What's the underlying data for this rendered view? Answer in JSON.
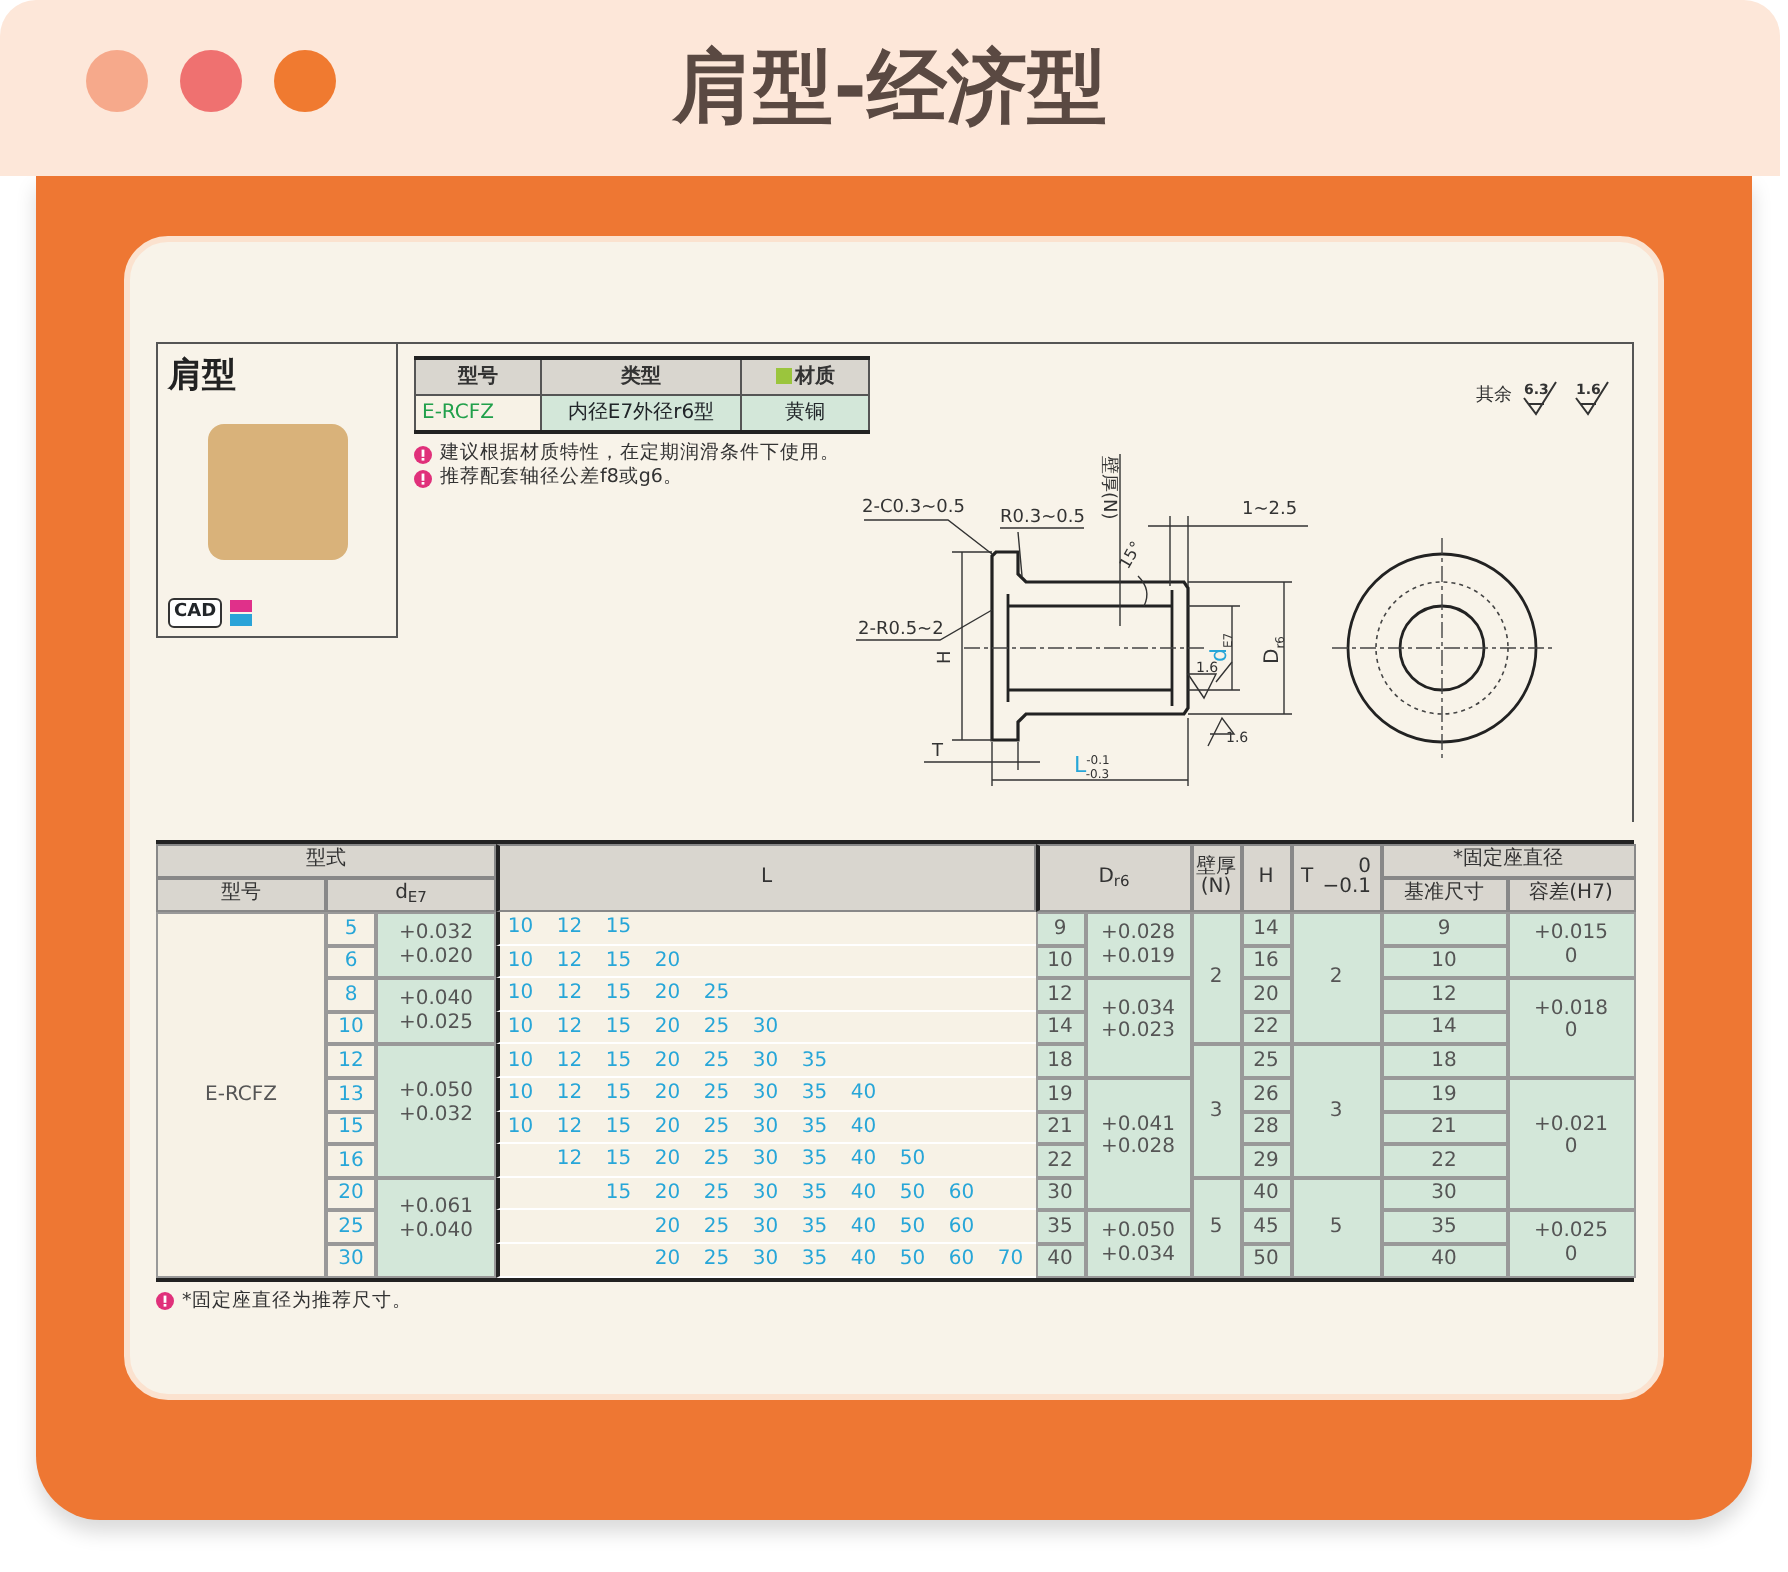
{
  "window": {
    "title": "肩型-经济型"
  },
  "product": {
    "title": "肩型",
    "cad": "CAD"
  },
  "spec_table": {
    "columns": [
      "型号",
      "类型",
      "材质"
    ],
    "rows": [
      [
        "E-RCFZ",
        "内径E7外径r6型",
        "黄铜"
      ]
    ]
  },
  "notes": [
    "建议根据材质特性，在定期润滑条件下使用。",
    "推荐配套轴径公差f8或g6。"
  ],
  "surface": {
    "label": "其余",
    "main": "6.3",
    "alt": "1.6"
  },
  "drawing": {
    "labels": [
      {
        "text": "2-C0.3~0.5"
      },
      {
        "text": "R0.3~0.5"
      },
      {
        "text": "壁厚(N)"
      },
      {
        "text": "1~2.5"
      },
      {
        "text": "15°"
      },
      {
        "text": "2-R0.5~2"
      },
      {
        "text": "H"
      },
      {
        "text": "T"
      },
      {
        "text": "L",
        "sup": "-0.1",
        "sub": "-0.3"
      },
      {
        "text": "d",
        "sub": "E7"
      },
      {
        "text": "D",
        "sub": "r6"
      },
      {
        "text": "1.6"
      },
      {
        "text": "1.6"
      }
    ]
  },
  "main_table": {
    "headers": {
      "group": "型式",
      "model": "型号",
      "d": "d$_{E7}$",
      "L": "L",
      "D": "D$_{r6}$",
      "N": [
        "壁厚",
        "(N)"
      ],
      "H": "H",
      "T": "T",
      "T_tol": [
        "0",
        "−0.1"
      ],
      "seat": "*固定座直径",
      "seat_size": "基准尺寸",
      "seat_tol": "容差(H7)"
    },
    "model": "E-RCFZ",
    "d_groups": [
      {
        "values": [
          "5",
          "6"
        ],
        "tolerance": [
          "+0.032",
          "+0.020"
        ]
      },
      {
        "values": [
          "8",
          "10"
        ],
        "tolerance": [
          "+0.040",
          "+0.025"
        ]
      },
      {
        "values": [
          "12",
          "13",
          "15",
          "16"
        ],
        "tolerance": [
          "+0.050",
          "+0.032"
        ]
      },
      {
        "values": [
          "20",
          "25",
          "30"
        ],
        "tolerance": [
          "+0.061",
          "+0.040"
        ]
      }
    ],
    "L_rows": [
      [
        "10",
        "12",
        "15",
        null,
        null,
        null,
        null,
        null,
        null,
        null,
        null
      ],
      [
        "10",
        "12",
        "15",
        "20",
        null,
        null,
        null,
        null,
        null,
        null,
        null
      ],
      [
        "10",
        "12",
        "15",
        "20",
        "25",
        null,
        null,
        null,
        null,
        null,
        null
      ],
      [
        "10",
        "12",
        "15",
        "20",
        "25",
        "30",
        null,
        null,
        null,
        null,
        null
      ],
      [
        "10",
        "12",
        "15",
        "20",
        "25",
        "30",
        "35",
        null,
        null,
        null,
        null
      ],
      [
        "10",
        "12",
        "15",
        "20",
        "25",
        "30",
        "35",
        "40",
        null,
        null,
        null
      ],
      [
        "10",
        "12",
        "15",
        "20",
        "25",
        "30",
        "35",
        "40",
        null,
        null,
        null
      ],
      [
        null,
        "12",
        "15",
        "20",
        "25",
        "30",
        "35",
        "40",
        "50",
        null,
        null
      ],
      [
        null,
        null,
        "15",
        "20",
        "25",
        "30",
        "35",
        "40",
        "50",
        "60",
        null
      ],
      [
        null,
        null,
        null,
        "20",
        "25",
        "30",
        "35",
        "40",
        "50",
        "60",
        null
      ],
      [
        null,
        null,
        null,
        "20",
        "25",
        "30",
        "35",
        "40",
        "50",
        "60",
        "70"
      ]
    ],
    "D_groups": [
      {
        "values": [
          "9",
          "10"
        ],
        "tolerance": [
          "+0.028",
          "+0.019"
        ]
      },
      {
        "values": [
          "12",
          "14",
          "18"
        ],
        "tolerance": [
          "+0.034",
          "+0.023"
        ]
      },
      {
        "values": [
          "19",
          "21",
          "22",
          "30"
        ],
        "tolerance": [
          "+0.041",
          "+0.028"
        ]
      },
      {
        "values": [
          "35",
          "40"
        ],
        "tolerance": [
          "+0.050",
          "+0.034"
        ]
      }
    ],
    "wall_groups": [
      {
        "N": "2",
        "T": "2",
        "H": [
          "14",
          "16",
          "20",
          "22"
        ]
      },
      {
        "N": "3",
        "T": "3",
        "H": [
          "25",
          "26",
          "28",
          "29"
        ]
      },
      {
        "N": "5",
        "T": "5",
        "H": [
          "40",
          "45",
          "50"
        ]
      }
    ],
    "seat_groups": [
      {
        "sizes": [
          "9",
          "10"
        ],
        "tolerance": [
          "+0.015",
          "0"
        ]
      },
      {
        "sizes": [
          "12",
          "14",
          "18"
        ],
        "tolerance": [
          "+0.018",
          "0"
        ]
      },
      {
        "sizes": [
          "19",
          "21",
          "22",
          "30"
        ],
        "tolerance": [
          "+0.021",
          "0"
        ]
      },
      {
        "sizes": [
          "35",
          "40"
        ],
        "tolerance": [
          "+0.025",
          "0"
        ]
      }
    ]
  },
  "footnote": "*固定座直径为推荐尺寸。"
}
